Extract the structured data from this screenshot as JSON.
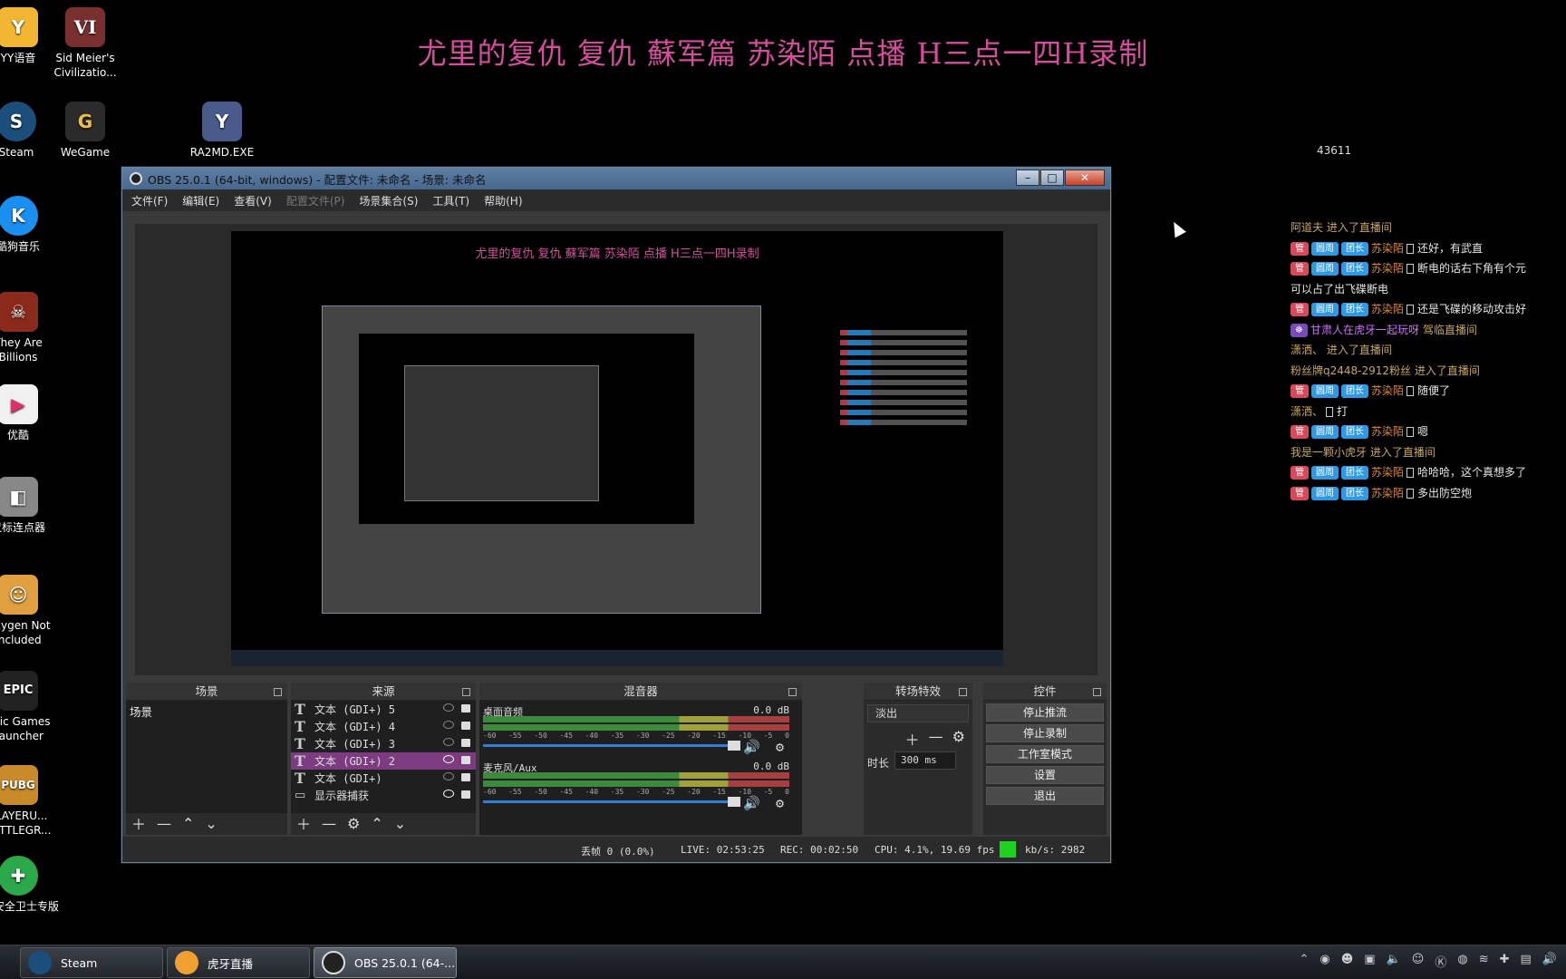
{
  "banner": "尤里的复仇 复仇 蘇军篇 苏染陌 点播 H三点一四H录制",
  "viewer_count": "43611",
  "desktop_icons": [
    {
      "label": "YY语音",
      "icon": "yy-icon",
      "color": "#f2b632"
    },
    {
      "label": "Sid Meier's Civilizatio...",
      "icon": "civilization-icon",
      "color": "#7a2f2f"
    },
    {
      "label": "Steam",
      "icon": "steam-icon",
      "color": "#1b4e7a"
    },
    {
      "label": "WeGame",
      "icon": "wegame-icon",
      "color": "#2b2b2b"
    },
    {
      "label": "RA2MD.EXE",
      "icon": "ra2-icon",
      "color": "#4a5a8a"
    },
    {
      "label": "酷狗音乐",
      "icon": "kugou-icon",
      "color": "#1a8ff0"
    },
    {
      "label": "They Are Billions",
      "icon": "they-are-billions-icon",
      "color": "#8a2a1a"
    },
    {
      "label": "优酷",
      "icon": "youku-icon",
      "color": "#f0f0f0"
    },
    {
      "label": "鼠标连点器",
      "icon": "mouse-clicker-icon",
      "color": "#888"
    },
    {
      "label": "Oxygen Not Included",
      "icon": "oxygen-not-included-icon",
      "color": "#e0a040"
    },
    {
      "label": "Epic Games Launcher",
      "icon": "epic-games-icon",
      "color": "#222"
    },
    {
      "label": "PLAYERU... BATTLEGR...",
      "icon": "pubg-icon",
      "color": "#c98a2a"
    },
    {
      "label": "游_安全卫士专版",
      "icon": "security-guard-icon",
      "color": "#2aa84a"
    }
  ],
  "chat": {
    "messages": [
      {
        "type": "enter",
        "user": "阿道夫",
        "text": "进入了直播间"
      },
      {
        "type": "msg",
        "tags": [
          "管",
          "圆周",
          "团长"
        ],
        "user": "苏染陌",
        "text": "还好，有武直"
      },
      {
        "type": "msg",
        "tags": [
          "管",
          "圆周",
          "团长"
        ],
        "user": "苏染陌",
        "text": "断电的话右下角有个元"
      },
      {
        "type": "cont",
        "text": "可以占了出飞碟断电"
      },
      {
        "type": "msg",
        "tags": [
          "管",
          "圆周",
          "团长"
        ],
        "user": "苏染陌",
        "text": "还是飞碟的移动攻击好"
      },
      {
        "type": "enter-gift",
        "user": "甘肃人在虎牙一起玩呀",
        "text": "驾临直播间"
      },
      {
        "type": "enter",
        "user": "潇洒、",
        "text": "进入了直播间"
      },
      {
        "type": "enter",
        "user": "粉丝牌q2448-2912粉丝",
        "text": "进入了直播间"
      },
      {
        "type": "msg",
        "tags": [
          "管",
          "圆周",
          "团长"
        ],
        "user": "苏染陌",
        "text": "随便了"
      },
      {
        "type": "plain",
        "user": "潇洒、",
        "text": "打"
      },
      {
        "type": "msg",
        "tags": [
          "管",
          "圆周",
          "团长"
        ],
        "user": "苏染陌",
        "text": "嗯"
      },
      {
        "type": "enter",
        "user": "我是一颗小虎牙",
        "text": "进入了直播间"
      },
      {
        "type": "msg",
        "tags": [
          "管",
          "圆周",
          "团长"
        ],
        "user": "苏染陌",
        "text": "哈哈哈，这个真想多了"
      },
      {
        "type": "msg",
        "tags": [
          "管",
          "圆周",
          "团长"
        ],
        "user": "苏染陌",
        "text": "多出防空炮"
      }
    ]
  },
  "obs": {
    "title": "OBS 25.0.1 (64-bit, windows) - 配置文件: 未命名 - 场景: 未命名",
    "menu": [
      "文件(F)",
      "编辑(E)",
      "查看(V)",
      "配置文件(P)",
      "场景集合(S)",
      "工具(T)",
      "帮助(H)"
    ],
    "preview_banner": "尤里的复仇 复仇 蘇军篇 苏染陌 点播 H三点一四H录制",
    "docks": {
      "scenes": {
        "title": "场景",
        "items": [
          "场景"
        ]
      },
      "sources": {
        "title": "来源",
        "items": [
          "文本 (GDI+) 5",
          "文本 (GDI+) 4",
          "文本 (GDI+) 3",
          "文本 (GDI+) 2",
          "文本 (GDI+)",
          "显示器捕获"
        ],
        "selected_index": 3
      },
      "mixer": {
        "title": "混音器",
        "channels": [
          {
            "name": "桌面音频",
            "db": "0.0 dB"
          },
          {
            "name": "麦克风/Aux",
            "db": "0.0 dB"
          }
        ],
        "scale": [
          "-60",
          "-55",
          "-50",
          "-45",
          "-40",
          "-35",
          "-30",
          "-25",
          "-20",
          "-15",
          "-10",
          "-5",
          "0"
        ]
      },
      "transitions": {
        "title": "转场特效",
        "selected": "淡出",
        "duration_label": "时长",
        "duration": "300 ms"
      },
      "controls": {
        "title": "控件",
        "buttons": [
          "停止推流",
          "停止录制",
          "工作室模式",
          "设置",
          "退出"
        ]
      }
    },
    "status": {
      "dropped": "丢帧 0 (0.0%)",
      "live": "LIVE: 02:53:25",
      "rec": "REC: 00:02:50",
      "cpu": "CPU: 4.1%, 19.69 fps",
      "kbps": "kb/s: 2982"
    }
  },
  "taskbar": {
    "items": [
      {
        "label": "Steam",
        "icon": "steam-icon"
      },
      {
        "label": "虎牙直播",
        "icon": "huya-icon"
      },
      {
        "label": "OBS 25.0.1 (64-...",
        "icon": "obs-icon"
      }
    ]
  }
}
